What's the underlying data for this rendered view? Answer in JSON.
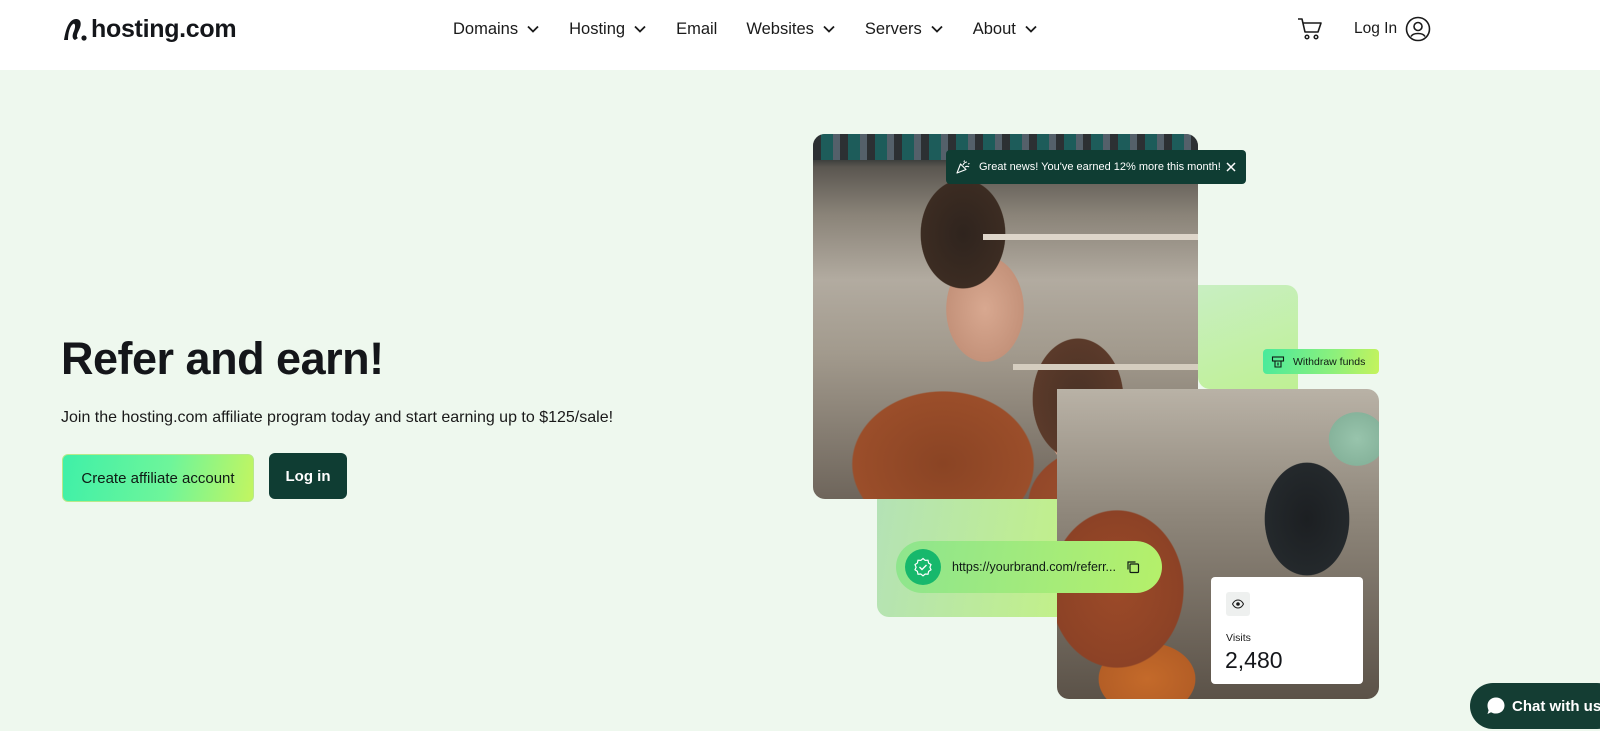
{
  "header": {
    "logo_text": "hosting.com",
    "nav": [
      {
        "label": "Domains",
        "has_dropdown": true
      },
      {
        "label": "Hosting",
        "has_dropdown": true
      },
      {
        "label": "Email",
        "has_dropdown": false
      },
      {
        "label": "Websites",
        "has_dropdown": true
      },
      {
        "label": "Servers",
        "has_dropdown": true
      },
      {
        "label": "About",
        "has_dropdown": true
      }
    ],
    "login_label": "Log In",
    "icons": {
      "cart": "cart-icon",
      "user": "user-icon"
    }
  },
  "hero": {
    "title": "Refer and earn!",
    "subtitle": "Join the hosting.com affiliate program today and start earning up to $125/sale!",
    "create_button": "Create affiliate account",
    "login_button": "Log in"
  },
  "visual": {
    "toast_text": "Great news! You've earned 12% more this month!",
    "withdraw_label": "Withdraw funds",
    "referral_url": "https://yourbrand.com/referr...",
    "visits_label": "Visits",
    "visits_value": "2,480"
  },
  "chat": {
    "label": "Chat with us"
  },
  "colors": {
    "background": "#eef8ee",
    "dark_green": "#0f3d33",
    "accent_green": "#3ff0a8",
    "lime": "#c3f560"
  }
}
